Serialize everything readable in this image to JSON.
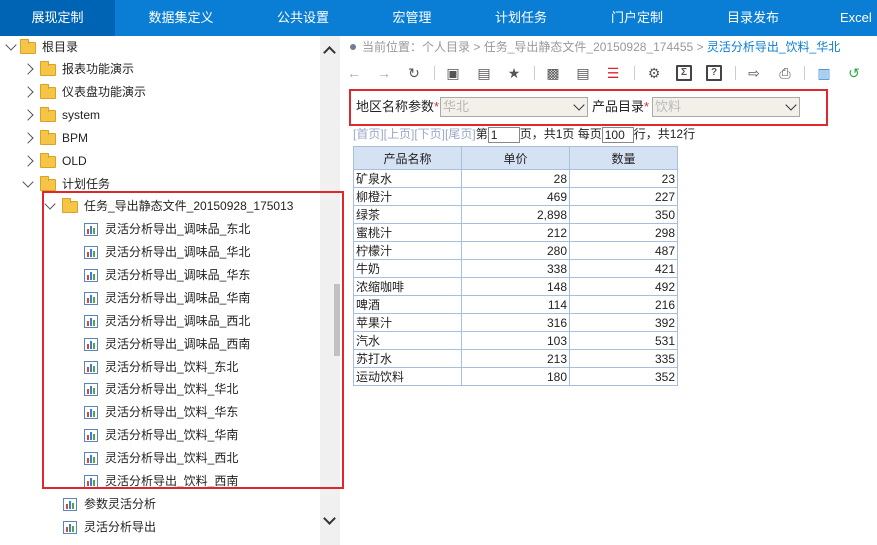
{
  "nav": {
    "tabs": [
      {
        "label": "展现定制",
        "active": true
      },
      {
        "label": "数据集定义"
      },
      {
        "label": "公共设置"
      },
      {
        "label": "宏管理"
      },
      {
        "label": "计划任务"
      },
      {
        "label": "门户定制"
      },
      {
        "label": "目录发布"
      },
      {
        "label": "Excel"
      }
    ]
  },
  "tree": {
    "root": "根目录",
    "items": [
      {
        "label": "报表功能演示"
      },
      {
        "label": "仪表盘功能演示"
      },
      {
        "label": "system"
      },
      {
        "label": "BPM"
      },
      {
        "label": "OLD"
      },
      {
        "label": "计划任务"
      }
    ],
    "task_folder": "任务_导出静态文件_20150928_175013",
    "reports": [
      "灵活分析导出_调味品_东北",
      "灵活分析导出_调味品_华北",
      "灵活分析导出_调味品_华东",
      "灵活分析导出_调味品_华南",
      "灵活分析导出_调味品_西北",
      "灵活分析导出_调味品_西南",
      "灵活分析导出_饮料_东北",
      "灵活分析导出_饮料_华北",
      "灵活分析导出_饮料_华东",
      "灵活分析导出_饮料_华南",
      "灵活分析导出_饮料_西北",
      "灵活分析导出_饮料_西南"
    ],
    "extra": [
      "参数灵活分析",
      "灵活分析导出"
    ]
  },
  "breadcrumb": {
    "prefix": "当前位置：",
    "parts": [
      "个人目录",
      "任务_导出静态文件_20150928_174455"
    ],
    "current": "灵活分析导出_饮料_华北",
    "sep": " > "
  },
  "params": {
    "region_label": "地区名称参数",
    "region_value": "华北",
    "catalog_label": "产品目录",
    "catalog_value": "饮料",
    "required_mark": "*"
  },
  "pager": {
    "first": "[首页]",
    "prev": "[上页]",
    "next": "[下页]",
    "last": "[尾页]",
    "page_prefix": "第",
    "page_value": "1",
    "page_suffix": "页，共1页",
    "per_prefix": "每页",
    "per_value": "100",
    "per_suffix": "行，共12行"
  },
  "table": {
    "headers": [
      "产品名称",
      "单价",
      "数量"
    ],
    "rows": [
      [
        "矿泉水",
        "28",
        "23"
      ],
      [
        "柳橙汁",
        "469",
        "227"
      ],
      [
        "绿茶",
        "2,898",
        "350"
      ],
      [
        "蜜桃汁",
        "212",
        "298"
      ],
      [
        "柠檬汁",
        "280",
        "487"
      ],
      [
        "牛奶",
        "338",
        "421"
      ],
      [
        "浓缩咖啡",
        "148",
        "492"
      ],
      [
        "啤酒",
        "114",
        "216"
      ],
      [
        "苹果汁",
        "316",
        "392"
      ],
      [
        "汽水",
        "103",
        "531"
      ],
      [
        "苏打水",
        "213",
        "335"
      ],
      [
        "运动饮料",
        "180",
        "352"
      ]
    ]
  },
  "colors": {
    "nav_bg": "#0a7dd4",
    "nav_active": "#0064b4",
    "highlight": "#e0272d",
    "table_header": "#d5e2f3"
  }
}
